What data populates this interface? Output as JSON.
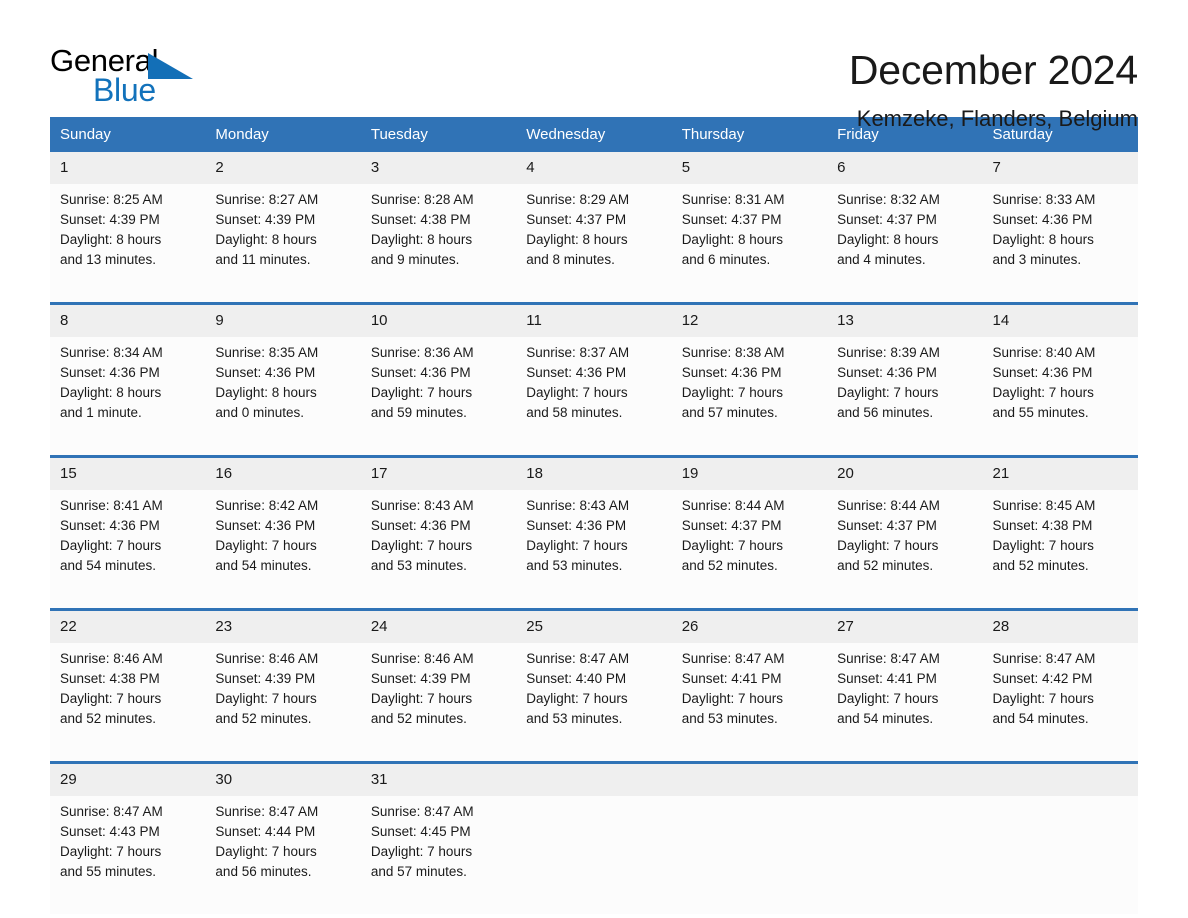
{
  "brand": {
    "name_top": "General",
    "name_bottom": "Blue",
    "triangle_color": "#136fb7",
    "blue_color": "#1272bb"
  },
  "header": {
    "month_title": "December 2024",
    "location": "Kemzeke, Flanders, Belgium"
  },
  "theme": {
    "header_blue": "#3073b6",
    "daynum_bg": "#efefef",
    "cell_bg": "#fcfcfc",
    "text": "#1a1a1a"
  },
  "calendar": {
    "weekday_headers": [
      "Sunday",
      "Monday",
      "Tuesday",
      "Wednesday",
      "Thursday",
      "Friday",
      "Saturday"
    ],
    "weeks": [
      [
        {
          "day": "1",
          "lines": [
            "Sunrise: 8:25 AM",
            "Sunset: 4:39 PM",
            "Daylight: 8 hours",
            "and 13 minutes."
          ]
        },
        {
          "day": "2",
          "lines": [
            "Sunrise: 8:27 AM",
            "Sunset: 4:39 PM",
            "Daylight: 8 hours",
            "and 11 minutes."
          ]
        },
        {
          "day": "3",
          "lines": [
            "Sunrise: 8:28 AM",
            "Sunset: 4:38 PM",
            "Daylight: 8 hours",
            "and 9 minutes."
          ]
        },
        {
          "day": "4",
          "lines": [
            "Sunrise: 8:29 AM",
            "Sunset: 4:37 PM",
            "Daylight: 8 hours",
            "and 8 minutes."
          ]
        },
        {
          "day": "5",
          "lines": [
            "Sunrise: 8:31 AM",
            "Sunset: 4:37 PM",
            "Daylight: 8 hours",
            "and 6 minutes."
          ]
        },
        {
          "day": "6",
          "lines": [
            "Sunrise: 8:32 AM",
            "Sunset: 4:37 PM",
            "Daylight: 8 hours",
            "and 4 minutes."
          ]
        },
        {
          "day": "7",
          "lines": [
            "Sunrise: 8:33 AM",
            "Sunset: 4:36 PM",
            "Daylight: 8 hours",
            "and 3 minutes."
          ]
        }
      ],
      [
        {
          "day": "8",
          "lines": [
            "Sunrise: 8:34 AM",
            "Sunset: 4:36 PM",
            "Daylight: 8 hours",
            "and 1 minute."
          ]
        },
        {
          "day": "9",
          "lines": [
            "Sunrise: 8:35 AM",
            "Sunset: 4:36 PM",
            "Daylight: 8 hours",
            "and 0 minutes."
          ]
        },
        {
          "day": "10",
          "lines": [
            "Sunrise: 8:36 AM",
            "Sunset: 4:36 PM",
            "Daylight: 7 hours",
            "and 59 minutes."
          ]
        },
        {
          "day": "11",
          "lines": [
            "Sunrise: 8:37 AM",
            "Sunset: 4:36 PM",
            "Daylight: 7 hours",
            "and 58 minutes."
          ]
        },
        {
          "day": "12",
          "lines": [
            "Sunrise: 8:38 AM",
            "Sunset: 4:36 PM",
            "Daylight: 7 hours",
            "and 57 minutes."
          ]
        },
        {
          "day": "13",
          "lines": [
            "Sunrise: 8:39 AM",
            "Sunset: 4:36 PM",
            "Daylight: 7 hours",
            "and 56 minutes."
          ]
        },
        {
          "day": "14",
          "lines": [
            "Sunrise: 8:40 AM",
            "Sunset: 4:36 PM",
            "Daylight: 7 hours",
            "and 55 minutes."
          ]
        }
      ],
      [
        {
          "day": "15",
          "lines": [
            "Sunrise: 8:41 AM",
            "Sunset: 4:36 PM",
            "Daylight: 7 hours",
            "and 54 minutes."
          ]
        },
        {
          "day": "16",
          "lines": [
            "Sunrise: 8:42 AM",
            "Sunset: 4:36 PM",
            "Daylight: 7 hours",
            "and 54 minutes."
          ]
        },
        {
          "day": "17",
          "lines": [
            "Sunrise: 8:43 AM",
            "Sunset: 4:36 PM",
            "Daylight: 7 hours",
            "and 53 minutes."
          ]
        },
        {
          "day": "18",
          "lines": [
            "Sunrise: 8:43 AM",
            "Sunset: 4:36 PM",
            "Daylight: 7 hours",
            "and 53 minutes."
          ]
        },
        {
          "day": "19",
          "lines": [
            "Sunrise: 8:44 AM",
            "Sunset: 4:37 PM",
            "Daylight: 7 hours",
            "and 52 minutes."
          ]
        },
        {
          "day": "20",
          "lines": [
            "Sunrise: 8:44 AM",
            "Sunset: 4:37 PM",
            "Daylight: 7 hours",
            "and 52 minutes."
          ]
        },
        {
          "day": "21",
          "lines": [
            "Sunrise: 8:45 AM",
            "Sunset: 4:38 PM",
            "Daylight: 7 hours",
            "and 52 minutes."
          ]
        }
      ],
      [
        {
          "day": "22",
          "lines": [
            "Sunrise: 8:46 AM",
            "Sunset: 4:38 PM",
            "Daylight: 7 hours",
            "and 52 minutes."
          ]
        },
        {
          "day": "23",
          "lines": [
            "Sunrise: 8:46 AM",
            "Sunset: 4:39 PM",
            "Daylight: 7 hours",
            "and 52 minutes."
          ]
        },
        {
          "day": "24",
          "lines": [
            "Sunrise: 8:46 AM",
            "Sunset: 4:39 PM",
            "Daylight: 7 hours",
            "and 52 minutes."
          ]
        },
        {
          "day": "25",
          "lines": [
            "Sunrise: 8:47 AM",
            "Sunset: 4:40 PM",
            "Daylight: 7 hours",
            "and 53 minutes."
          ]
        },
        {
          "day": "26",
          "lines": [
            "Sunrise: 8:47 AM",
            "Sunset: 4:41 PM",
            "Daylight: 7 hours",
            "and 53 minutes."
          ]
        },
        {
          "day": "27",
          "lines": [
            "Sunrise: 8:47 AM",
            "Sunset: 4:41 PM",
            "Daylight: 7 hours",
            "and 54 minutes."
          ]
        },
        {
          "day": "28",
          "lines": [
            "Sunrise: 8:47 AM",
            "Sunset: 4:42 PM",
            "Daylight: 7 hours",
            "and 54 minutes."
          ]
        }
      ],
      [
        {
          "day": "29",
          "lines": [
            "Sunrise: 8:47 AM",
            "Sunset: 4:43 PM",
            "Daylight: 7 hours",
            "and 55 minutes."
          ]
        },
        {
          "day": "30",
          "lines": [
            "Sunrise: 8:47 AM",
            "Sunset: 4:44 PM",
            "Daylight: 7 hours",
            "and 56 minutes."
          ]
        },
        {
          "day": "31",
          "lines": [
            "Sunrise: 8:47 AM",
            "Sunset: 4:45 PM",
            "Daylight: 7 hours",
            "and 57 minutes."
          ]
        },
        {
          "day": "",
          "lines": []
        },
        {
          "day": "",
          "lines": []
        },
        {
          "day": "",
          "lines": []
        },
        {
          "day": "",
          "lines": []
        }
      ]
    ]
  }
}
